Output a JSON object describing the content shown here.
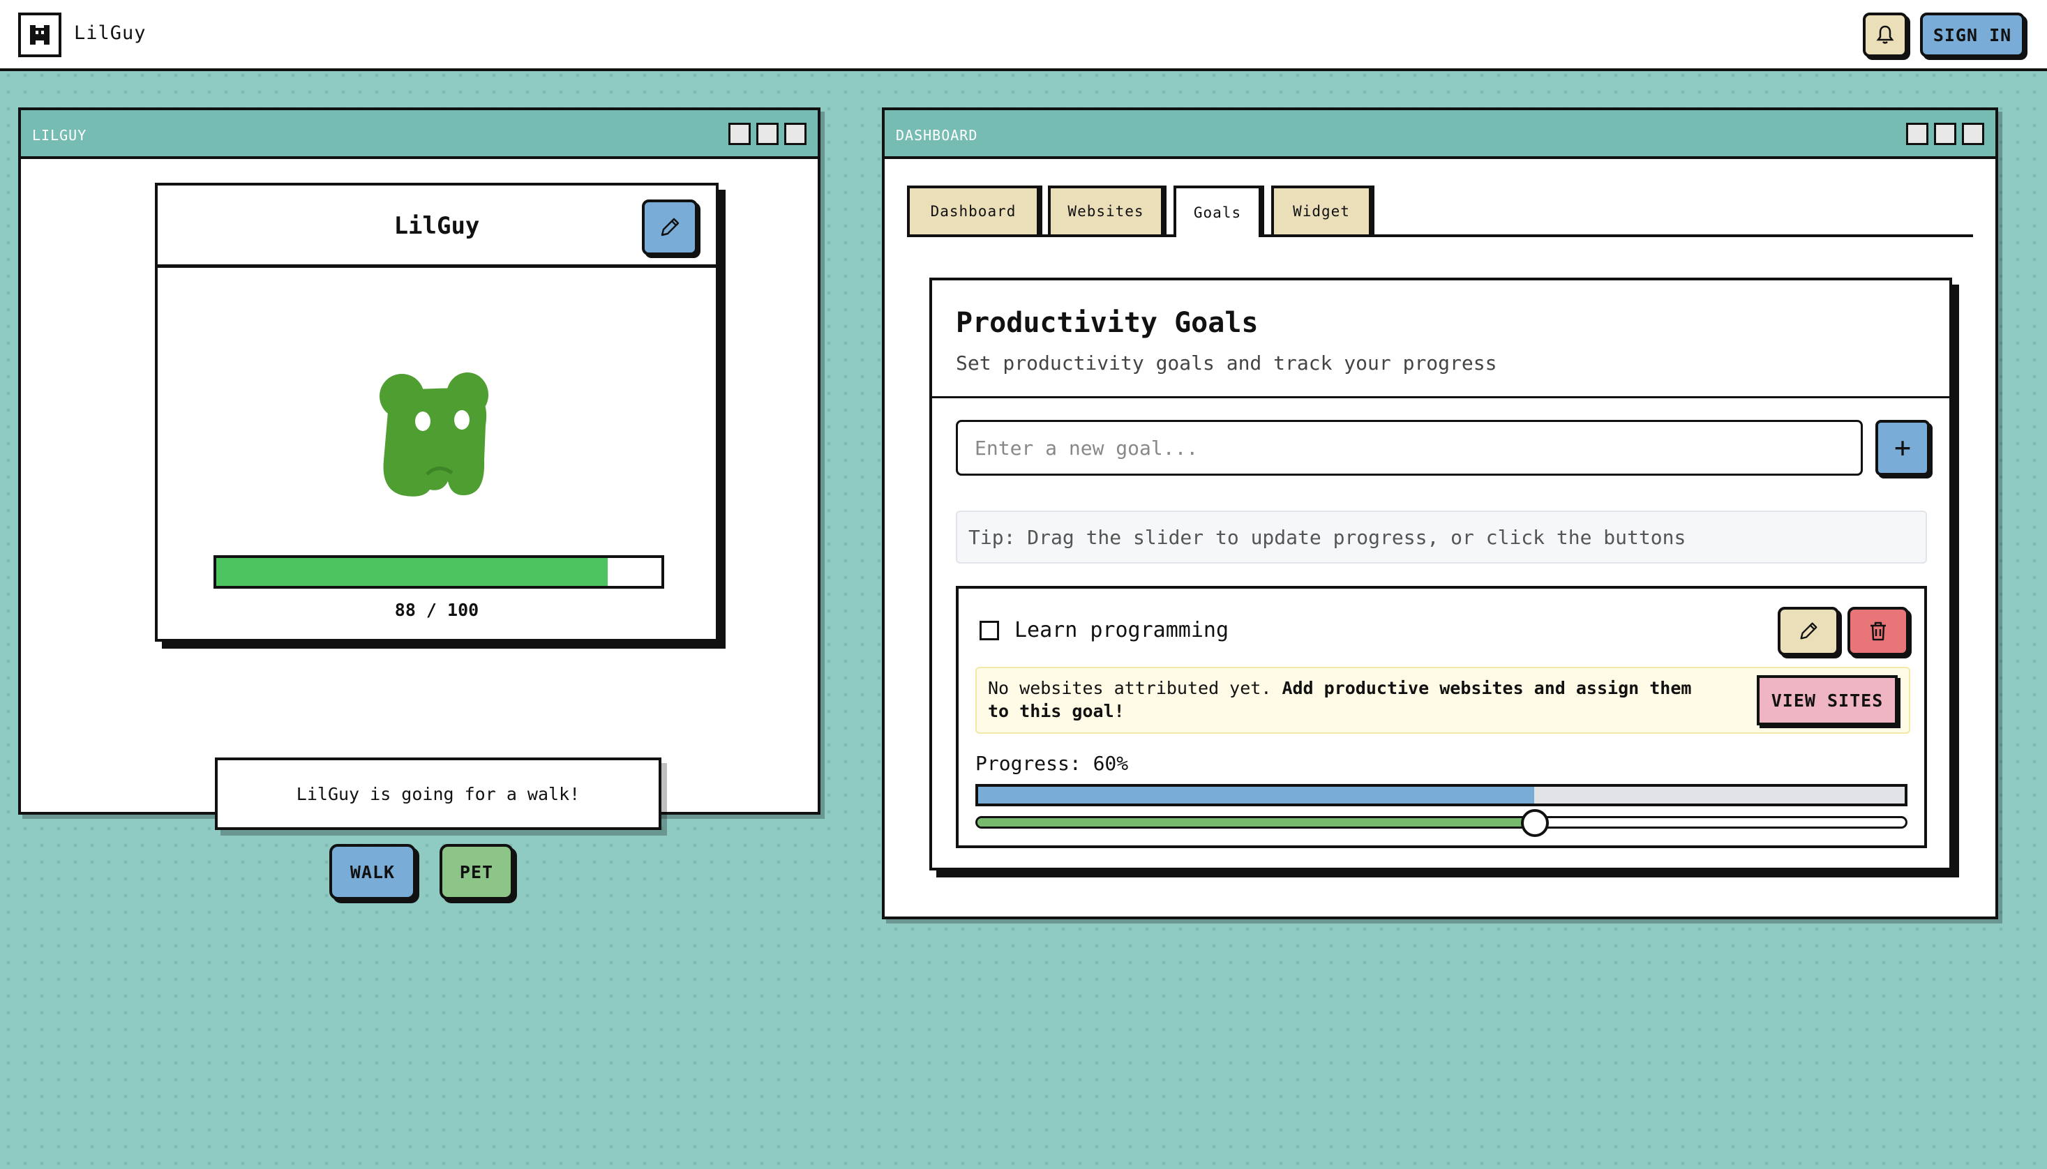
{
  "app": {
    "name": "LilGuy",
    "sign_in_label": "SIGN IN",
    "icons": {
      "logo": "pet-logo-icon",
      "notifications": "bell-icon"
    }
  },
  "pet_window": {
    "title": "LILGUY",
    "pet_name": "LilGuy",
    "health": {
      "current": 88,
      "max": 100,
      "text": "88 / 100",
      "fraction": 0.88
    },
    "status_message": "LilGuy is going for a walk!",
    "buttons": {
      "walk": "WALK",
      "pet": "PET"
    },
    "colors": {
      "pet": "#4f9e32",
      "health_bar": "#4dc45f"
    }
  },
  "dashboard_window": {
    "title": "DASHBOARD",
    "tabs": [
      {
        "label": "Dashboard",
        "active": false
      },
      {
        "label": "Websites",
        "active": false
      },
      {
        "label": "Goals",
        "active": true
      },
      {
        "label": "Widget",
        "active": false
      }
    ],
    "goals": {
      "title": "Productivity Goals",
      "subtitle": "Set productivity goals and track your progress",
      "input_placeholder": "Enter a new goal...",
      "add_label": "+",
      "tip": "Tip: Drag the slider to update progress, or click the buttons",
      "items": [
        {
          "label": "Learn programming",
          "completed": false,
          "notice_plain": "No websites attributed yet.",
          "notice_bold": " Add productive websites and assign them to this goal!",
          "view_sites_label": "VIEW SITES",
          "progress_label": "Progress: 60%",
          "progress": 0.6
        }
      ]
    }
  }
}
